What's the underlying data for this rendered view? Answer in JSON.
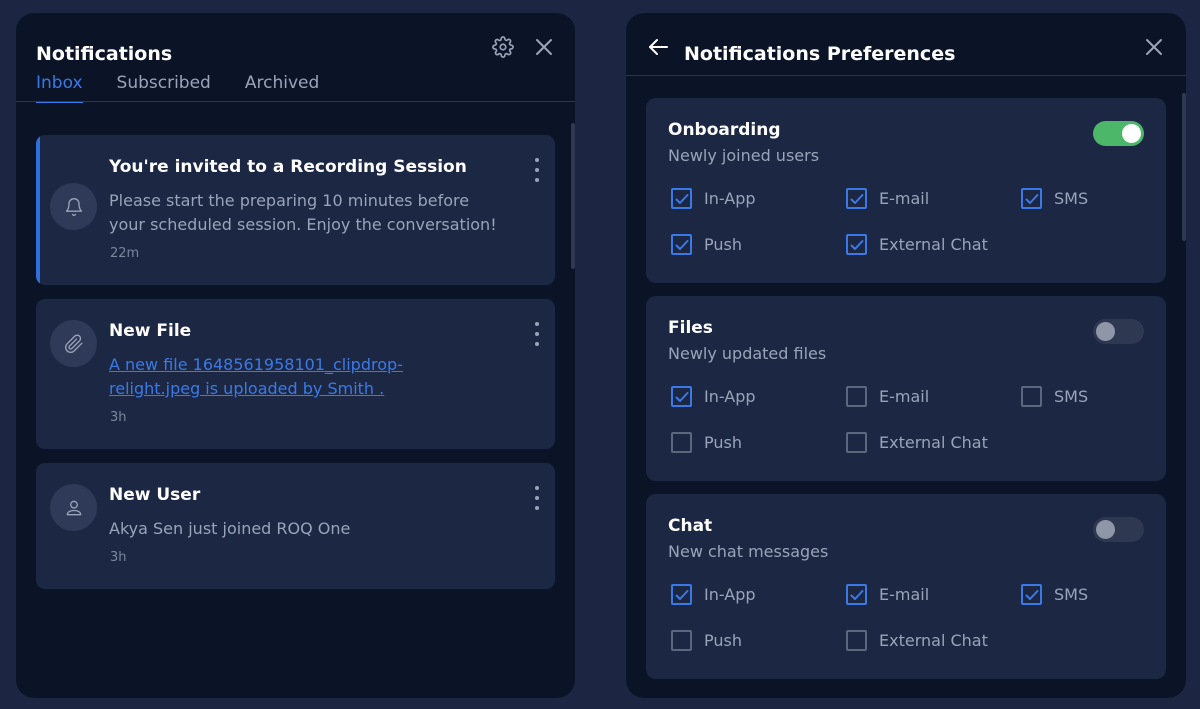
{
  "inbox_panel": {
    "title": "Notifications",
    "tabs": [
      "Inbox",
      "Subscribed",
      "Archived"
    ],
    "active_tab": "Inbox",
    "notifications": [
      {
        "icon": "bell-icon",
        "title": "You're invited to a Recording Session",
        "body": "Please start the preparing 10 minutes before your scheduled session. Enjoy the conversation!",
        "time": "22m",
        "unread": true
      },
      {
        "icon": "paperclip-icon",
        "title": "New File",
        "link": "A new file 1648561958101_clipdrop-relight.jpeg is uploaded by Smith .",
        "time": "3h",
        "unread": false
      },
      {
        "icon": "user-icon",
        "title": "New User",
        "body": "Akya Sen just joined ROQ One",
        "time": "3h",
        "unread": false
      }
    ]
  },
  "prefs_panel": {
    "title": "Notifications Preferences",
    "channels": [
      "In-App",
      "E-mail",
      "SMS",
      "Push",
      "External Chat"
    ],
    "sections": [
      {
        "title": "Onboarding",
        "subtitle": "Newly joined users",
        "enabled": true,
        "checked": {
          "In-App": true,
          "E-mail": true,
          "SMS": true,
          "Push": true,
          "External Chat": true
        }
      },
      {
        "title": "Files",
        "subtitle": "Newly updated files",
        "enabled": false,
        "checked": {
          "In-App": true,
          "E-mail": false,
          "SMS": false,
          "Push": false,
          "External Chat": false
        }
      },
      {
        "title": "Chat",
        "subtitle": "New chat messages",
        "enabled": false,
        "checked": {
          "In-App": true,
          "E-mail": true,
          "SMS": true,
          "Push": false,
          "External Chat": false
        }
      }
    ]
  },
  "colors": {
    "accent": "#3b7ae6",
    "toggle_on": "#4cb768",
    "panel_bg": "#0b1427",
    "card_bg": "#1c2744"
  }
}
